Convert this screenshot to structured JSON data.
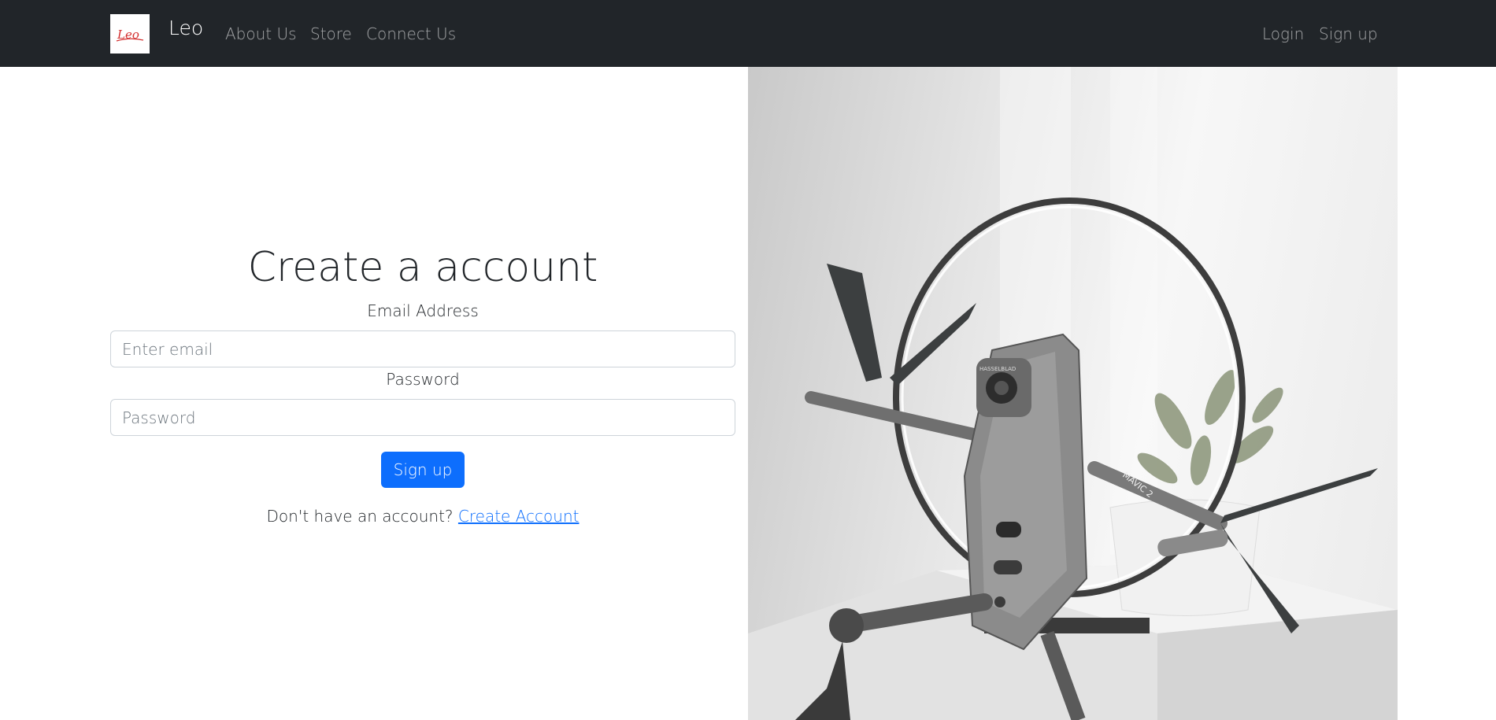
{
  "navbar": {
    "brand_logo_text": "Leo",
    "brand_name": "Leo",
    "links": [
      "About Us",
      "Store",
      "Connect Us"
    ],
    "login_label": "Login",
    "signup_label": "Sign up"
  },
  "form": {
    "title": "Create a account",
    "email_label": "Email Address",
    "email_placeholder": "Enter email",
    "email_value": "",
    "password_label": "Password",
    "password_placeholder": "Password",
    "password_value": "",
    "submit_label": "Sign up",
    "prompt_text": "Don't have an account?",
    "prompt_link": "Create Account"
  },
  "hero": {
    "drone_label": "MAVIC 2",
    "camera_label": "HASSELBLAD"
  },
  "colors": {
    "navbar_bg": "#212529",
    "primary": "#0d6efd",
    "logo_red": "#d32f2f"
  }
}
